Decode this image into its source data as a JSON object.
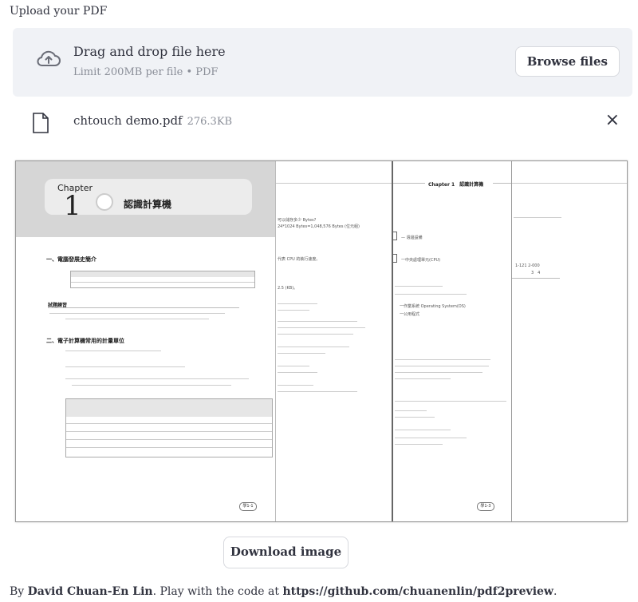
{
  "uploader": {
    "label": "Upload your PDF",
    "dropzone_title": "Drag and drop file here",
    "dropzone_subtitle": "Limit 200MB per file • PDF",
    "browse_label": "Browse files",
    "icons": [
      "cloud-upload-icon",
      "file-icon",
      "close-icon"
    ]
  },
  "file": {
    "name": "chtouch demo.pdf",
    "size": "276.3KB",
    "close_label": "×"
  },
  "preview": {
    "page1": {
      "chapter_word": "Chapter",
      "chapter_number": "1",
      "chapter_title": "認識計算機",
      "section1": "一、電腦發展史簡介",
      "quiz_heading": "試題練習",
      "section2": "二、電子計算機常用的計量單位",
      "page_tag": "學1-1"
    },
    "page2": {
      "line1": "可以儲存多少 Bytes?",
      "line2": "24*1024 Bytes=1,048,576 Bytes (位元組)",
      "line3": "代表 CPU 的執行速度。",
      "line4": "2.5 (KB)。"
    },
    "page3": {
      "header": "Chapter 1　認識計算機",
      "line1": "一中央處理單元(CPU)",
      "line2": "一作業系統 Operating System(OS)",
      "line3": "一公用程式",
      "page_tag": "學1-3"
    },
    "page4": {
      "line1": "1-121 2-000",
      "line2": "3　4"
    }
  },
  "download_label": "Download image",
  "footer": {
    "prefix": "By ",
    "author": "David Chuan-En Lin",
    "middle": ". Play with the code at ",
    "link": "https://github.com/chuanenlin/pdf2preview",
    "suffix": "."
  }
}
